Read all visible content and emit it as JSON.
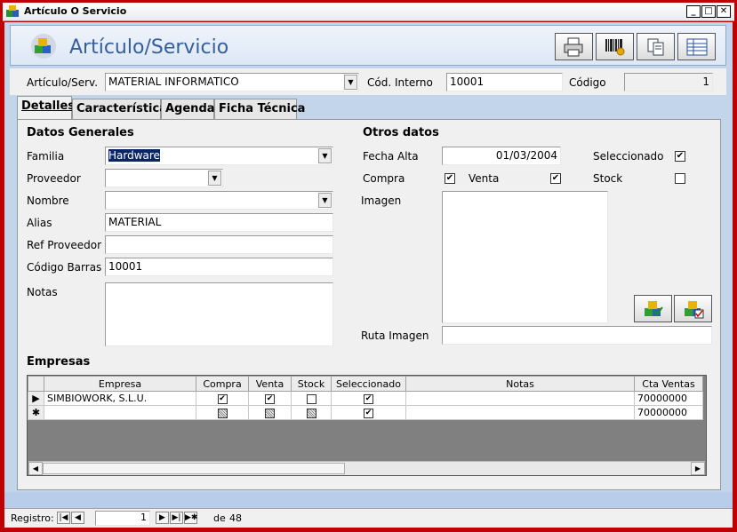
{
  "window": {
    "title": "Artículo O Servicio"
  },
  "header": {
    "title": "Artículo/Servicio"
  },
  "top": {
    "articulo_label": "Artículo/Serv.",
    "articulo_value": "MATERIAL INFORMATICO",
    "cod_interno_label": "Cód. Interno",
    "cod_interno_value": "10001",
    "codigo_label": "Código",
    "codigo_value": "1"
  },
  "tabs": [
    {
      "label": "Detalles"
    },
    {
      "label": "Características"
    },
    {
      "label": "Agenda"
    },
    {
      "label": "Ficha Técnica"
    }
  ],
  "datos_generales": {
    "title": "Datos Generales",
    "familia_label": "Familia",
    "familia_value": "Hardware",
    "proveedor_label": "Proveedor",
    "proveedor_value": "",
    "nombre_label": "Nombre",
    "nombre_value": "",
    "alias_label": "Alias",
    "alias_value": "MATERIAL",
    "ref_proveedor_label": "Ref Proveedor",
    "ref_proveedor_value": "",
    "codigo_barras_label": "Código Barras",
    "codigo_barras_value": "10001",
    "notas_label": "Notas",
    "notas_value": ""
  },
  "otros_datos": {
    "title": "Otros datos",
    "fecha_alta_label": "Fecha Alta",
    "fecha_alta_value": "01/03/2004",
    "seleccionado_label": "Seleccionado",
    "seleccionado_checked": true,
    "compra_label": "Compra",
    "compra_checked": true,
    "venta_label": "Venta",
    "venta_checked": true,
    "stock_label": "Stock",
    "stock_checked": false,
    "imagen_label": "Imagen",
    "ruta_imagen_label": "Ruta Imagen",
    "ruta_imagen_value": ""
  },
  "empresas": {
    "title": "Empresas",
    "columns": [
      "Empresa",
      "Compra",
      "Venta",
      "Stock",
      "Seleccionado",
      "Notas",
      "Cta Ventas"
    ],
    "rows": [
      {
        "empresa": "SIMBIOWORK, S.L.U.",
        "compra": "checked",
        "venta": "checked",
        "stock": "unchecked",
        "seleccionado": "checked",
        "notas": "",
        "cta_ventas": "70000000"
      },
      {
        "empresa": "",
        "compra": "indeterminate",
        "venta": "indeterminate",
        "stock": "indeterminate",
        "seleccionado": "checked",
        "notas": "",
        "cta_ventas": "70000000"
      }
    ]
  },
  "status": {
    "registro_label": "Registro:",
    "current": "1",
    "de_label": "de",
    "total": "48"
  },
  "colors": {
    "titlebar_border": "#c00000",
    "header_text": "#355f9c",
    "band": "#c3d5ea"
  }
}
